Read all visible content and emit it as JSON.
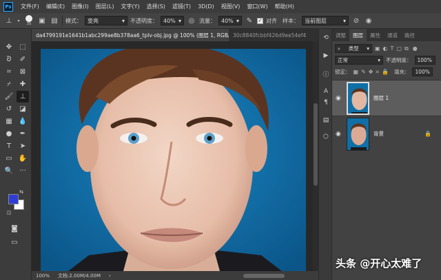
{
  "menubar": {
    "logo": "Ps",
    "items": [
      "文件(F)",
      "编辑(E)",
      "图像(I)",
      "图层(L)",
      "文字(Y)",
      "选择(S)",
      "滤镜(T)",
      "3D(D)",
      "视图(V)",
      "窗口(W)",
      "帮助(H)"
    ]
  },
  "options": {
    "brush_size": "35",
    "mode_label": "模式：",
    "mode_value": "变亮",
    "opacity_label": "不透明度：",
    "opacity_value": "40%",
    "flow_label": "流量：",
    "flow_value": "40%",
    "aligned_label": "对齐",
    "sample_label": "样本：",
    "sample_value": "当前图层"
  },
  "tabs": [
    {
      "label": "da4799191e1641b1abc299ae8b378aa6_tplv-obj.jpg @ 100% (图层 1, RGB/8) *",
      "close": "×"
    },
    {
      "label": "30c8840fcbbf426d9ee54ef4",
      "close": ""
    }
  ],
  "status": {
    "zoom": "100%",
    "doc": "文档:2.00M/4.00M",
    "arrow": "›"
  },
  "panel": {
    "tabs": [
      "调整",
      "图层",
      "属性",
      "通道",
      "路径"
    ],
    "active_tab": 1,
    "filter_kind": "类型",
    "blend_mode": "正常",
    "opacity_label": "不透明度：",
    "opacity_value": "100%",
    "lock_label": "锁定：",
    "fill_label": "填充：",
    "fill_value": "100%",
    "layers": [
      {
        "name": "图层 1",
        "selected": true
      },
      {
        "name": "背景",
        "selected": false,
        "locked": true
      }
    ]
  },
  "icons": {
    "eye": "eye-icon",
    "lock": "lock-icon",
    "clone_stamp": "clone-stamp-icon"
  },
  "colors": {
    "foreground": "#2e3ed4",
    "background": "#ffffff",
    "photo_backdrop": "#0f6fa6"
  },
  "watermark": "头条 @开心太难了"
}
